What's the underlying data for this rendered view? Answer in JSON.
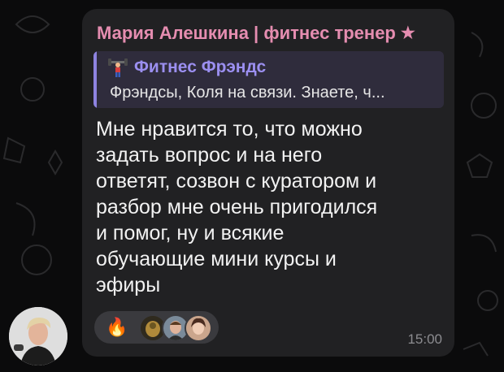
{
  "message": {
    "sender": "Мария Алешкина | фитнес тренер",
    "sender_icon": "star-icon",
    "reply": {
      "title": "Фитнес Фрэндс",
      "icon": "weightlifter-icon",
      "preview": "Фрэндсы, Коля на связи. Знаете, ч..."
    },
    "text": "Мне нравится то, что можно\nзадать вопрос и на него\nответят, созвон с куратором и\nразбор мне очень пригодился\nи помог, ну и всякие\nобучающие мини курсы и\nэфиры",
    "reaction": {
      "emoji": "🔥",
      "reactors": [
        "reactor-avatar-1",
        "reactor-avatar-2",
        "reactor-avatar-3"
      ]
    },
    "time": "15:00"
  },
  "colors": {
    "background": "#0b0b0c",
    "bubble": "#212123",
    "sender": "#e58db0",
    "reply_accent": "#8e83e0",
    "reply_bg": "#2f2c3c"
  }
}
